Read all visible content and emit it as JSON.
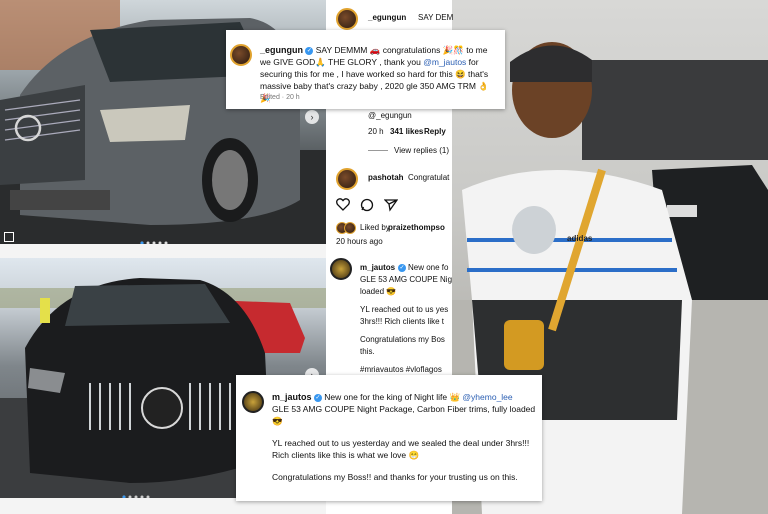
{
  "strip": {
    "top_user": "_egungun",
    "top_snippet": "SAY DEM",
    "handle_mention": "@_egungun",
    "reply_time": "20 h",
    "reply_likes": "341 likes",
    "reply_label": "Reply",
    "view_replies": "View replies (1)",
    "commenter_user": "pashotah",
    "commenter_snippet": "Congratulat",
    "liked_by_prefix": "Liked by",
    "liked_by_user": "praizethompso",
    "posted_time": "20 hours ago",
    "jautos_user": "m_jautos",
    "jautos_line1": "New one fo",
    "jautos_line2": "GLE 53 AMG COUPE Nig",
    "jautos_line3": "loaded 😎",
    "jautos_line4": "YL reached out to us yes",
    "jautos_line5": "3hrs!!! Rich clients like t",
    "jautos_line6": "Congratulations my Bos",
    "jautos_line7": "this.",
    "hashtags": "#mriavautos #vloflagos"
  },
  "egungun_card": {
    "username": "_egungun",
    "body_start": "SAY DEMMM 🚗 congratulations 🎉🎊 to me we GIVE GOD🙏 THE GLORY , thank you ",
    "mention": "@m_jautos",
    "body_end": " for securing this for me , I have worked so hard for this 😆 that's massive baby that's crazy baby , 2020 gle 350 AMG TRM 👌 🎉",
    "meta": "Edited · 20 h"
  },
  "jautos_card": {
    "username": "m_jautos",
    "line1_start": "New one for the king of Night life 👑 ",
    "line1_mention": "@yhemo_lee",
    "line2": "GLE 53 AMG COUPE Night Package, Carbon Fiber trims, fully loaded 😎",
    "para2": "YL reached out to us yesterday and we sealed the deal under 3hrs!!! Rich clients like this is what we love 😁",
    "para3": "Congratulations my Boss!! and thanks for your trusting us on this."
  },
  "photos": {
    "shirt_brand": "adidas"
  },
  "colors": {
    "link_blue": "#2b5fb3",
    "verified_blue": "#3897f0"
  }
}
